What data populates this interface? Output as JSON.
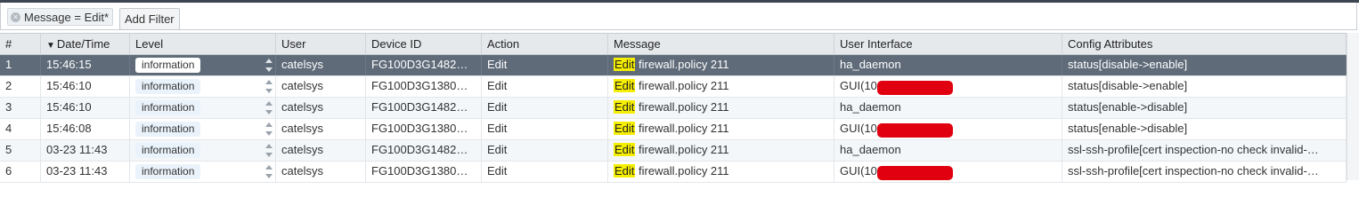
{
  "filter": {
    "chip_label": "Message = Edit*",
    "add_filter_label": "Add Filter"
  },
  "columns": [
    "#",
    "Date/Time",
    "Level",
    "User",
    "Device ID",
    "Action",
    "Message",
    "User Interface",
    "Config Attributes"
  ],
  "sort": {
    "column": "Date/Time",
    "direction": "desc"
  },
  "rows": [
    {
      "num": "1",
      "datetime": "15:46:15",
      "level": "information",
      "user": "catelsys",
      "device": "FG100D3G1482…",
      "action": "Edit",
      "msg_hl": "Edit",
      "msg_rest": "firewall.policy 211",
      "ui": "ha_daemon",
      "ui_redacted": false,
      "config": "status[disable->enable]",
      "selected": true
    },
    {
      "num": "2",
      "datetime": "15:46:10",
      "level": "information",
      "user": "catelsys",
      "device": "FG100D3G1380…",
      "action": "Edit",
      "msg_hl": "Edit",
      "msg_rest": "firewall.policy 211",
      "ui": "GUI(10",
      "ui_redacted": true,
      "config": "status[disable->enable]",
      "selected": false
    },
    {
      "num": "3",
      "datetime": "15:46:10",
      "level": "information",
      "user": "catelsys",
      "device": "FG100D3G1482…",
      "action": "Edit",
      "msg_hl": "Edit",
      "msg_rest": "firewall.policy 211",
      "ui": "ha_daemon",
      "ui_redacted": false,
      "config": "status[enable->disable]",
      "selected": false
    },
    {
      "num": "4",
      "datetime": "15:46:08",
      "level": "information",
      "user": "catelsys",
      "device": "FG100D3G1380…",
      "action": "Edit",
      "msg_hl": "Edit",
      "msg_rest": "firewall.policy 211",
      "ui": "GUI(10",
      "ui_redacted": true,
      "config": "status[enable->disable]",
      "selected": false
    },
    {
      "num": "5",
      "datetime": "03-23 11:43",
      "level": "information",
      "user": "catelsys",
      "device": "FG100D3G1482…",
      "action": "Edit",
      "msg_hl": "Edit",
      "msg_rest": "firewall.policy 211",
      "ui": "ha_daemon",
      "ui_redacted": false,
      "config": "ssl-ssh-profile[cert inspection-no check invalid-…",
      "selected": false
    },
    {
      "num": "6",
      "datetime": "03-23 11:43",
      "level": "information",
      "user": "catelsys",
      "device": "FG100D3G1380…",
      "action": "Edit",
      "msg_hl": "Edit",
      "msg_rest": "firewall.policy 211",
      "ui": "GUI(10",
      "ui_redacted": true,
      "config": "ssl-ssh-profile[cert inspection-no check invalid-…",
      "selected": false
    }
  ]
}
